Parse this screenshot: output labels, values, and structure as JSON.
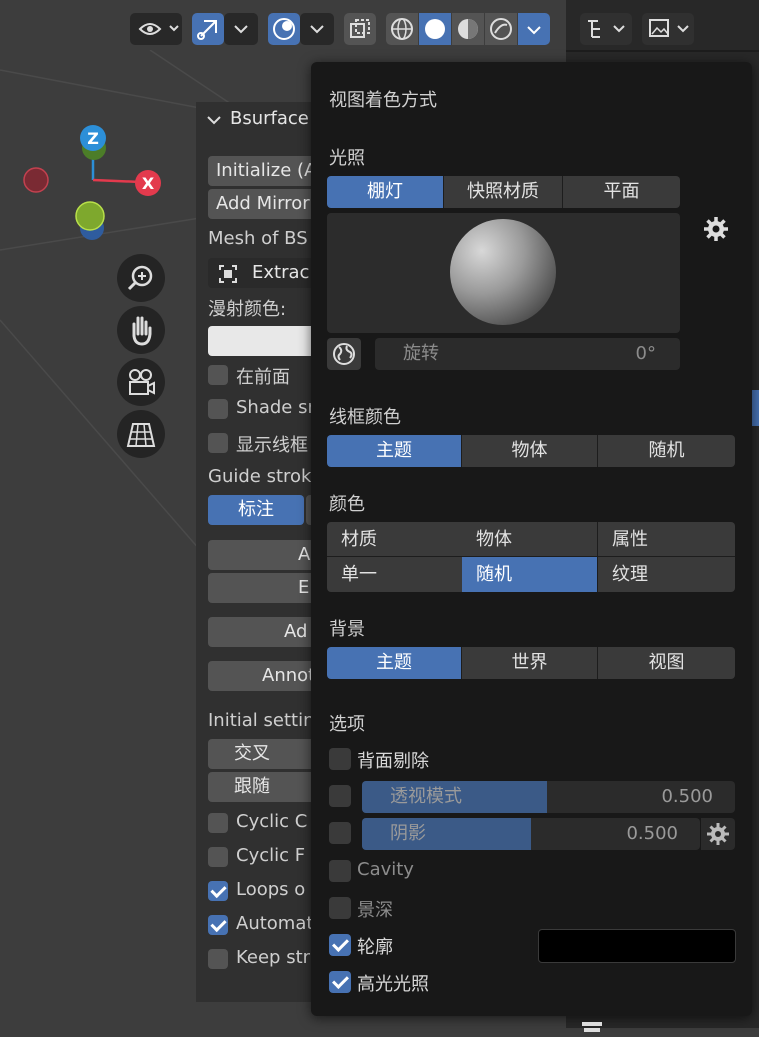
{
  "popover": {
    "title": "视图着色方式",
    "lighting": {
      "label": "光照",
      "options": [
        "棚灯",
        "快照材质",
        "平面"
      ],
      "active": "棚灯",
      "rotation_label": "旋转",
      "rotation_value": "0°"
    },
    "wireframe_color": {
      "label": "线框颜色",
      "options": [
        "主题",
        "物体",
        "随机"
      ],
      "active": "主题"
    },
    "color": {
      "label": "颜色",
      "options": [
        "材质",
        "物体",
        "属性",
        "单一",
        "随机",
        "纹理"
      ],
      "active": "随机"
    },
    "background": {
      "label": "背景",
      "options": [
        "主题",
        "世界",
        "视图"
      ],
      "active": "主题"
    },
    "options": {
      "label": "选项",
      "backface_culling": {
        "label": "背面剔除",
        "checked": false
      },
      "xray": {
        "label": "透视模式",
        "value": "0.500",
        "fraction": 0.5,
        "checked": false
      },
      "shadow": {
        "label": "阴影",
        "value": "0.500",
        "fraction": 0.5,
        "checked": false
      },
      "cavity": {
        "label": "Cavity",
        "checked": false
      },
      "dof": {
        "label": "景深",
        "checked": false
      },
      "outline": {
        "label": "轮廓",
        "checked": true,
        "color": "#000000"
      },
      "specular": {
        "label": "高光光照",
        "checked": true
      }
    }
  },
  "npanel": {
    "header": "Bsurface",
    "initialize": "Initialize (A",
    "add_mirror": "Add Mirror",
    "mesh_of": "Mesh of BS",
    "extract": "Extrac",
    "diffuse_color": "漫射颜色:",
    "in_front": "在前面",
    "shade_smooth": "Shade sr",
    "show_wire": "显示线框",
    "guide_strokes": "Guide strok",
    "annotate_tab": "标注",
    "btn_a": "A",
    "btn_e": "E",
    "btn_add": "Ad",
    "btn_annot": "Annot",
    "initial_settings": "Initial settin",
    "cross": "交叉",
    "follow": "跟随",
    "cyclic_c": "Cyclic C",
    "cyclic_f": "Cyclic F",
    "loops_on": "Loops o",
    "automatic": "Automat",
    "keep_strokes": "Keep str"
  },
  "gizmo": {
    "z": "Z",
    "x": "X"
  },
  "colors": {
    "accent": "#4772b3",
    "popover_bg": "#181818",
    "x_axis": "#e33a4d",
    "z_axis": "#2c8fd8",
    "y_axis": "#8bc53e"
  }
}
